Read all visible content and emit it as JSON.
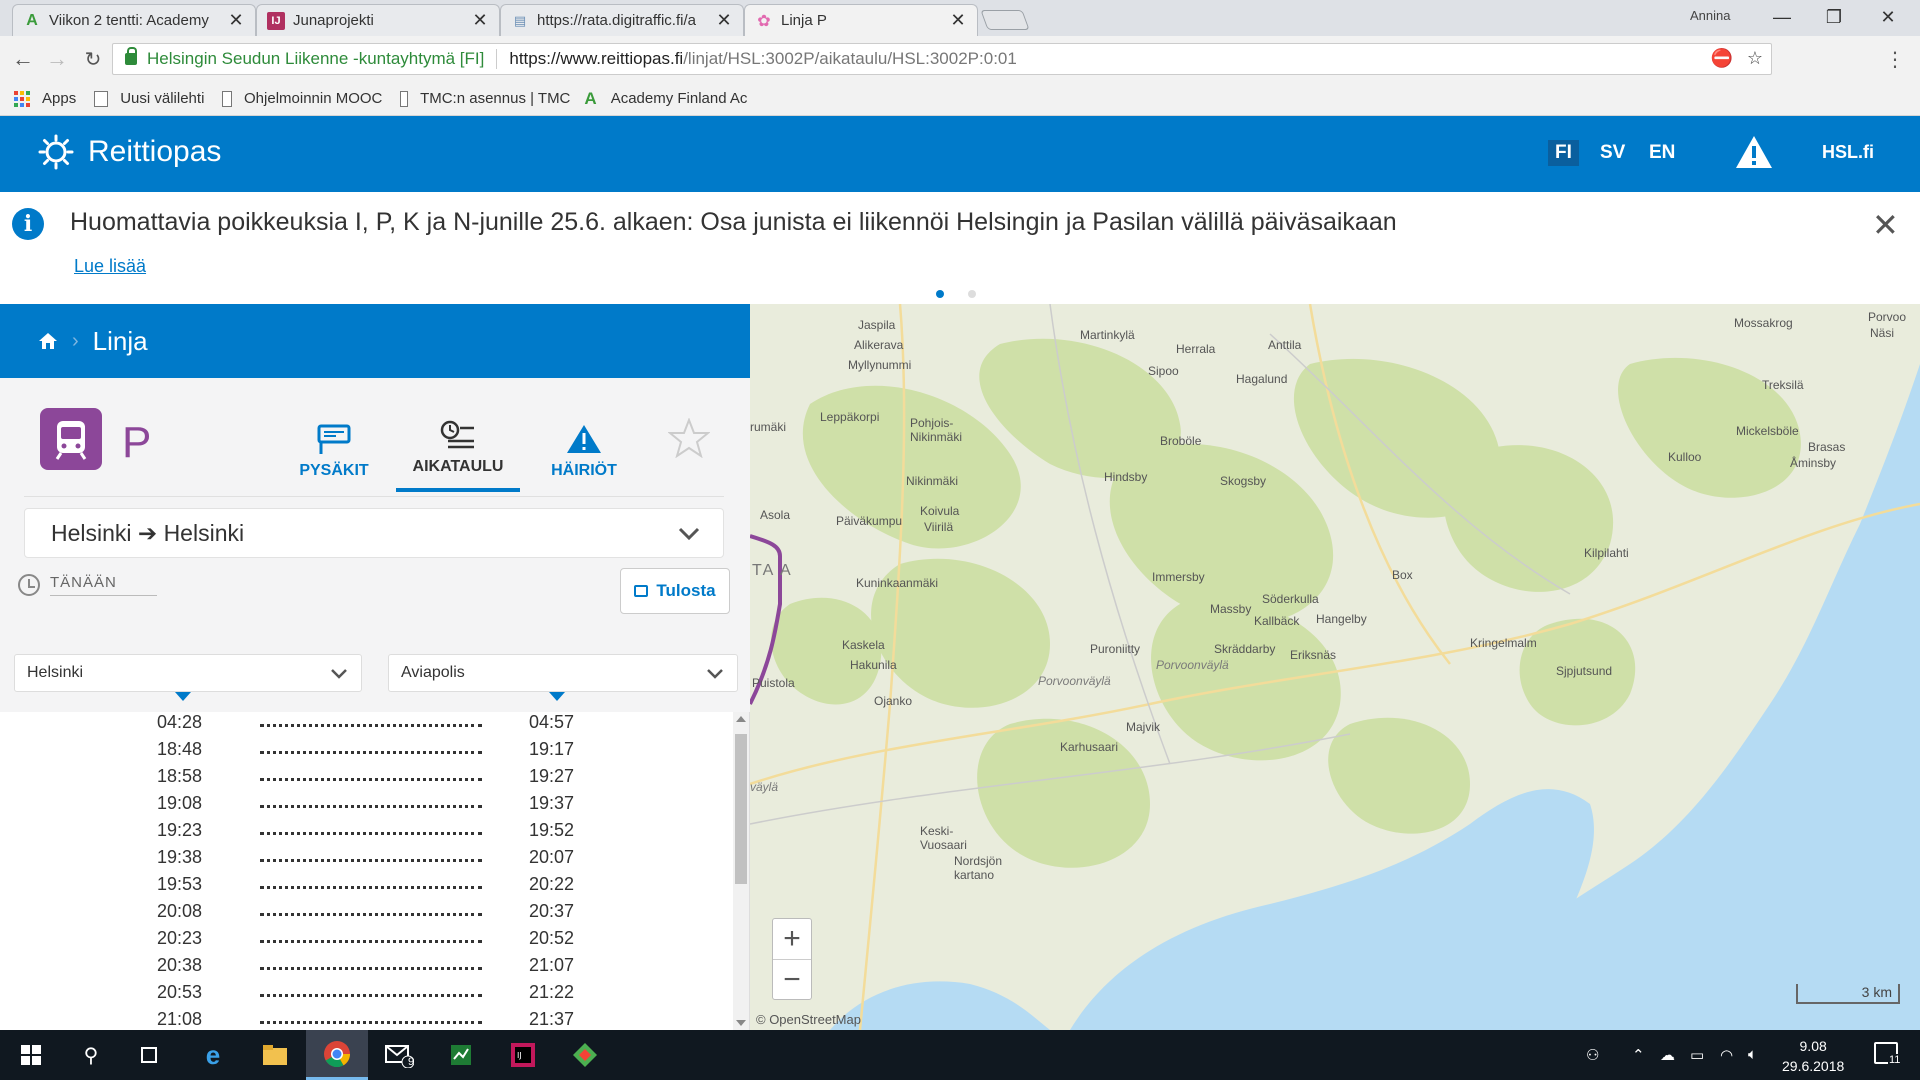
{
  "browser": {
    "tabs": [
      {
        "label": "Viikon 2 tentti: Academy",
        "icon": "academy-icon"
      },
      {
        "label": "Junaprojekti",
        "icon": "intellij-icon"
      },
      {
        "label": "https://rata.digitraffic.fi/a",
        "icon": "page-icon"
      },
      {
        "label": "Linja P",
        "icon": "hsl-icon"
      }
    ],
    "profile": "Annina",
    "cert_name": "Helsingin Seudun Liikenne -kuntayhtymä [FI]",
    "url_host": "https://www.reittiopas.fi",
    "url_path": "/linjat/HSL:3002P/aikataulu/HSL:3002P:0:01",
    "bookmarks": [
      {
        "label": "Apps"
      },
      {
        "label": "Uusi välilehti"
      },
      {
        "label": "Ohjelmoinnin MOOC"
      },
      {
        "label": "TMC:n asennus | TMC"
      },
      {
        "label": "Academy Finland Ac"
      }
    ]
  },
  "header": {
    "brand": "Reittiopas",
    "languages": [
      "FI",
      "SV",
      "EN"
    ],
    "selected_language": "FI",
    "hsl_link": "HSL.fi",
    "brand_color": "#007ac9"
  },
  "notice": {
    "text": "Huomattavia poikkeuksia I, P, K ja N-junille 25.6. alkaen: Osa junista ei liikennöi Helsingin ja Pasilan välillä päiväsaikaan",
    "link": "Lue lisää"
  },
  "panel": {
    "breadcrumb_title": "Linja",
    "route_letter": "P",
    "route_color": "#8c4799",
    "tabs": [
      "PYSÄKIT",
      "AIKATAULU",
      "HÄIRIÖT"
    ],
    "active_tab": "AIKATAULU",
    "direction": "Helsinki ➔ Helsinki",
    "date": "TÄNÄÄN",
    "print_label": "Tulosta",
    "from_stop": "Helsinki",
    "to_stop": "Aviapolis",
    "departures": [
      {
        "dep": "04:28",
        "arr": "04:57"
      },
      {
        "dep": "18:48",
        "arr": "19:17"
      },
      {
        "dep": "18:58",
        "arr": "19:27"
      },
      {
        "dep": "19:08",
        "arr": "19:37"
      },
      {
        "dep": "19:23",
        "arr": "19:52"
      },
      {
        "dep": "19:38",
        "arr": "20:07"
      },
      {
        "dep": "19:53",
        "arr": "20:22"
      },
      {
        "dep": "20:08",
        "arr": "20:37"
      },
      {
        "dep": "20:23",
        "arr": "20:52"
      },
      {
        "dep": "20:38",
        "arr": "21:07"
      },
      {
        "dep": "20:53",
        "arr": "21:22"
      },
      {
        "dep": "21:08",
        "arr": "21:37"
      }
    ]
  },
  "map": {
    "places": [
      "Jaspila",
      "Alikerava",
      "Myllynummi",
      "Martinkylä",
      "Herrala",
      "Anttila",
      "Sipoo",
      "Hagalund",
      "Mossakrog",
      "Porvoo",
      "Näsi",
      "Treksilä",
      "Leppäkorpi",
      "Pohjois-Nikinmäki",
      "rumäki",
      "Broböle",
      "Mickelsböle",
      "Brasas",
      "Åminsby",
      "Kulloo",
      "Nikinmäki",
      "Hindsby",
      "Skogsby",
      "Asola",
      "Päiväkumpu",
      "Koivula",
      "Viirilä",
      "Kilpilahti",
      "Kuninkaanmäki",
      "Immersby",
      "Box",
      "Massby",
      "Söderkulla",
      "Kallbäck",
      "Hangelby",
      "Kaskela",
      "Hakunila",
      "Puroniitty",
      "Skräddarby",
      "Eriksnäs",
      "Kringelmalm",
      "Puistola",
      "Sjpjutsund",
      "Ojanko",
      "Majvik",
      "Karhusaari",
      "Keski-Vuosaari",
      "Nordsjön kartano"
    ],
    "roads": [
      "Porvoonväylä",
      "Porvoonväylä",
      "väylä"
    ],
    "area_label": "TA A",
    "attribution": "© OpenStreetMap",
    "scale": "3 km",
    "zoom_in": "+",
    "zoom_out": "−"
  },
  "taskbar": {
    "time": "9.08",
    "date": "29.6.2018",
    "notification_count": "11",
    "mail_badge": "9"
  }
}
